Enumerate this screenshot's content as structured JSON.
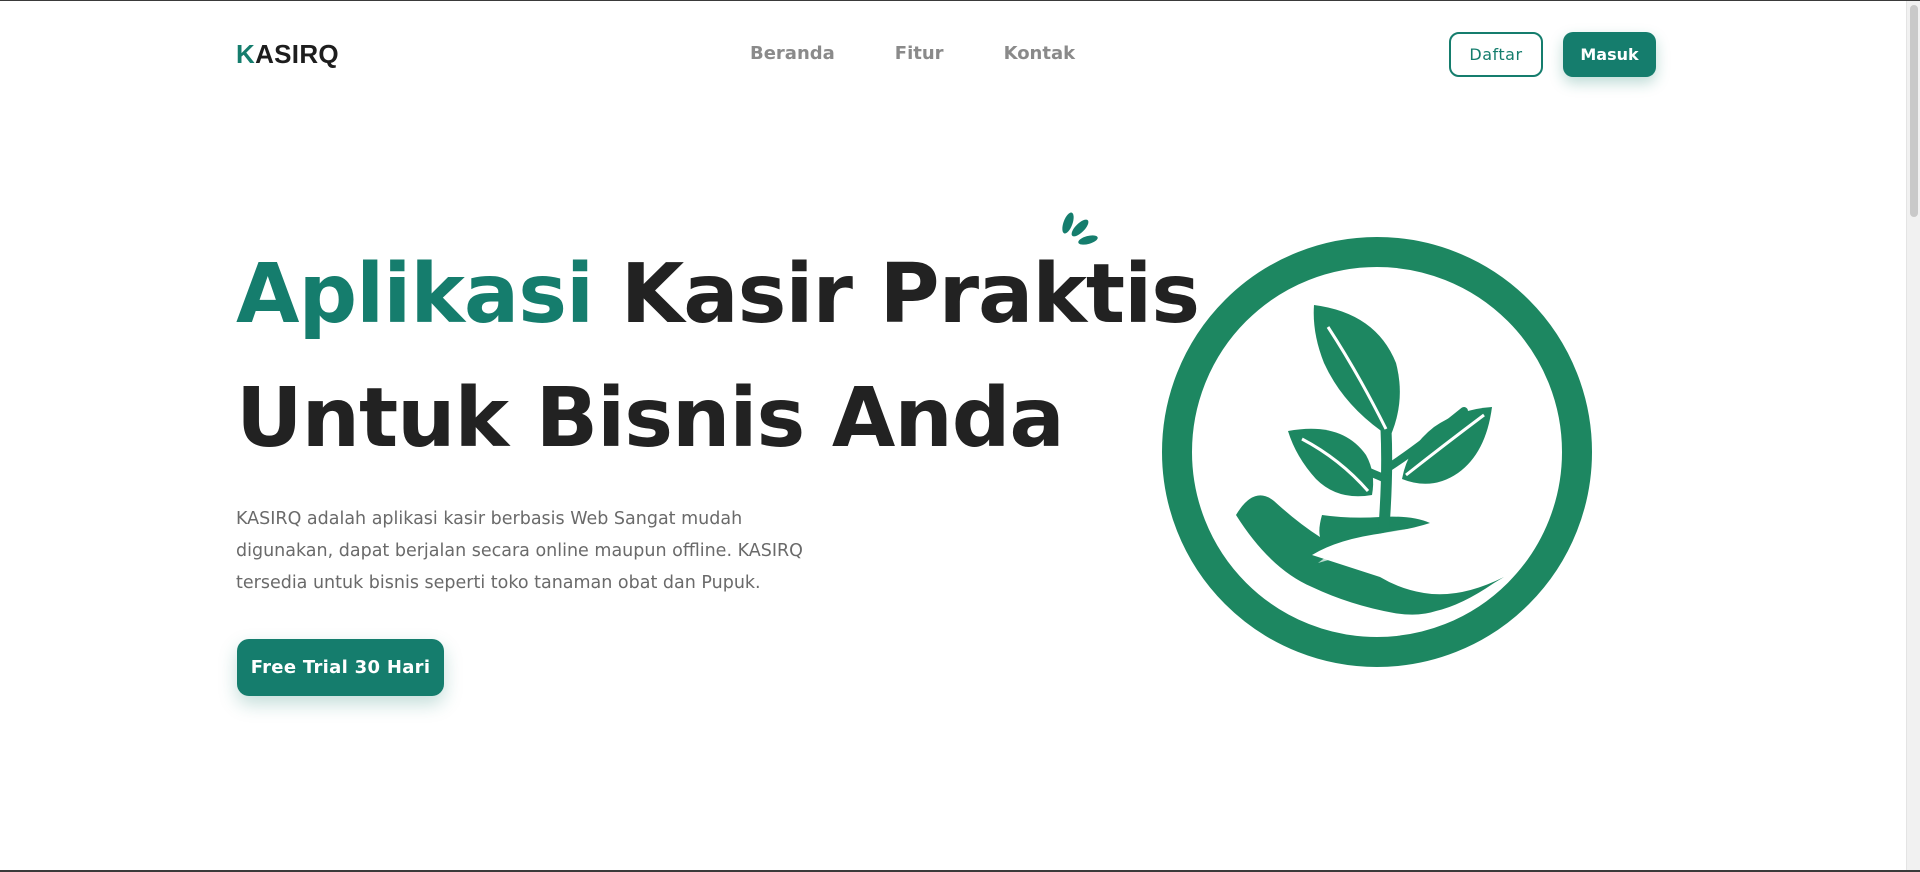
{
  "navbar": {
    "logo_initial": "K",
    "logo_rest": "ASIRQ",
    "links": [
      "Beranda",
      "Fitur",
      "Kontak"
    ],
    "register_label": "Daftar",
    "login_label": "Masuk"
  },
  "hero": {
    "title_accent": "Aplikasi",
    "title_line1_rest": " Kasir Praktis",
    "title_line2": "Untuk Bisnis Anda",
    "description": "KASIRQ adalah aplikasi kasir berbasis Web Sangat mudah digunakan, dapat berjalan secara online maupun offline. KASIRQ tersedia untuk bisnis seperti toko tanaman obat dan Pupuk.",
    "cta_label": "Free Trial 30 Hari",
    "image_icon": "plant-in-hand-logo-icon",
    "sparkle_icon": "sparkle-icon"
  },
  "colors": {
    "brand": "#157d6d",
    "logo_green": "#1d8761",
    "text_dark": "#222222",
    "text_muted": "#6a6a6a"
  }
}
